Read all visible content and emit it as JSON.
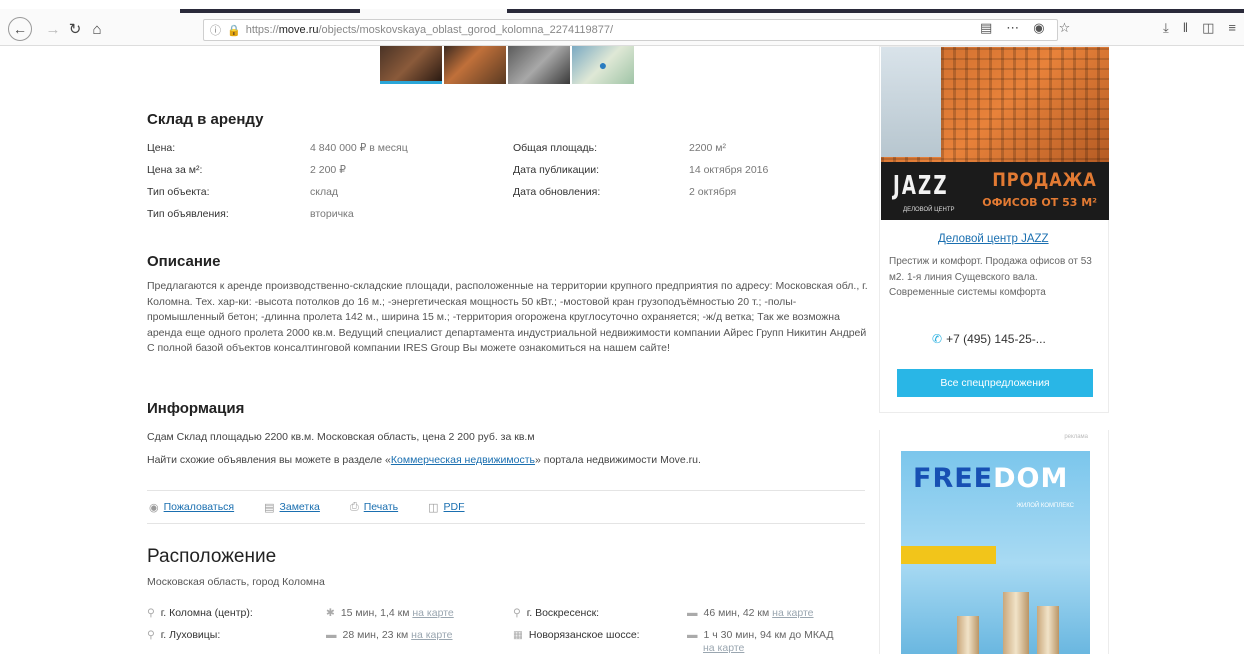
{
  "browser": {
    "url_prefix": "https://",
    "url_host": "move.ru",
    "url_path": "/objects/moskovskaya_oblast_gorod_kolomna_2274119877/"
  },
  "listing": {
    "title": "Склад в аренду",
    "props_left": [
      {
        "label": "Цена:",
        "value": "4 840 000 ₽ в месяц"
      },
      {
        "label": "Цена за м²:",
        "value": "2 200 ₽"
      },
      {
        "label": "Тип объекта:",
        "value": "склад"
      },
      {
        "label": "Тип объявления:",
        "value": "вторичка"
      }
    ],
    "props_right": [
      {
        "label": "Общая площадь:",
        "value": "2200 м²"
      },
      {
        "label": "Дата публикации:",
        "value": "14 октября 2016"
      },
      {
        "label": "Дата обновления:",
        "value": "2 октября"
      }
    ]
  },
  "description": {
    "heading": "Описание",
    "text": "Предлагаются к аренде производственно-складские площади, расположенные на территории крупного предприятия по адресу: Московская обл., г. Коломна. Тех. хар-ки: -высота потолков до 16 м.; -энергетическая мощность 50 кВт.; -мостовой кран грузоподъёмностью 20 т.; -полы-промышленный бетон; -длинна пролета 142 м., ширина 15 м.; -территория огорожена круглосуточно охраняется; -ж/д ветка; Так же возможна аренда еще одного пролета 2000 кв.м. Ведущий специалист департамента индустриальной недвижимости компании Айрес Групп Никитин Андрей С полной базой объектов консалтинговой компании IRES Group Вы можете ознакомиться на нашем сайте!"
  },
  "information": {
    "heading": "Информация",
    "line1": "Сдам Склад площадью 2200 кв.м. Московская область, цена 2 200 руб. за кв.м",
    "line2_before": "Найти схожие объявления вы можете в разделе «",
    "line2_link": "Коммерческая недвижимость",
    "line2_after": "» портала недвижимости Move.ru."
  },
  "actions": {
    "complain": "Пожаловаться",
    "note": "Заметка",
    "print": "Печать",
    "pdf": "PDF"
  },
  "location": {
    "heading": "Расположение",
    "address": "Московская область, город Коломна",
    "on_map": "на карте",
    "items": [
      {
        "place": "г. Коломна (центр):",
        "dist": "15 мин, 1,4 км"
      },
      {
        "place": "г. Воскресенск:",
        "dist": "46 мин, 42 км"
      },
      {
        "place": "г. Луховицы:",
        "dist": "28 мин, 23 км"
      },
      {
        "place": "Новорязанское шоссе:",
        "dist": "1 ч 30 мин, 94 км до МКАД"
      }
    ]
  },
  "sidebar": {
    "ad1": {
      "brand": "JAZZ",
      "brand_sub": "ДЕЛОВОЙ ЦЕНТР",
      "banner_line1": "ПРОДАЖА",
      "banner_line2": "ОФИСОВ ОТ 53 М²",
      "link": "Деловой центр JAZZ",
      "text": "Престиж и комфорт. Продажа офисов от 53 м2. 1-я линия Сущевского вала. Современные системы комфорта",
      "phone": "+7 (495) 145-25-...",
      "button": "Все спецпредложения"
    },
    "ad2": {
      "tag": "реклама",
      "brand_part1": "FREE",
      "brand_part2": "DOM",
      "brand_sub": "ЖИЛОЙ КОМПЛЕКС"
    }
  }
}
